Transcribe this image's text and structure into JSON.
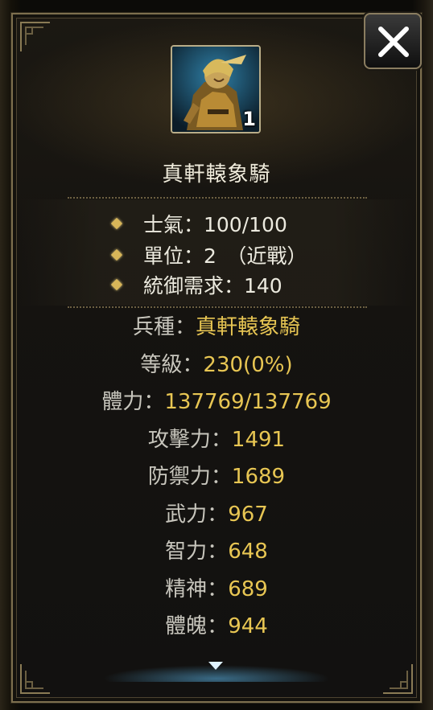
{
  "backdrop": {
    "title_fragment": ""
  },
  "unit": {
    "name": "真軒轅象騎",
    "count": "1"
  },
  "summary": [
    {
      "text": "士氣：100/100"
    },
    {
      "text": "單位：2　（近戰）"
    },
    {
      "text": "統御需求：140"
    }
  ],
  "stats": [
    {
      "label": "兵種：",
      "value": "真軒轅象騎"
    },
    {
      "label": "等級：",
      "value": "230(0%)"
    },
    {
      "label": "體力：",
      "value": "137769/137769"
    },
    {
      "label": "攻擊力：",
      "value": "1491"
    },
    {
      "label": "防禦力：",
      "value": "1689"
    },
    {
      "label": "武力：",
      "value": "967"
    },
    {
      "label": "智力：",
      "value": "648"
    },
    {
      "label": "精神：",
      "value": "689"
    },
    {
      "label": "體魄：",
      "value": "944"
    }
  ],
  "icons": {
    "close": "close-x-icon",
    "scroll": "scroll-down-arrow-icon",
    "bullet": "diamond-bullet-icon"
  },
  "colors": {
    "value_gold": "#e8c653",
    "label_gray": "#c8c6bd",
    "frame_gold": "#7d6f4e"
  }
}
